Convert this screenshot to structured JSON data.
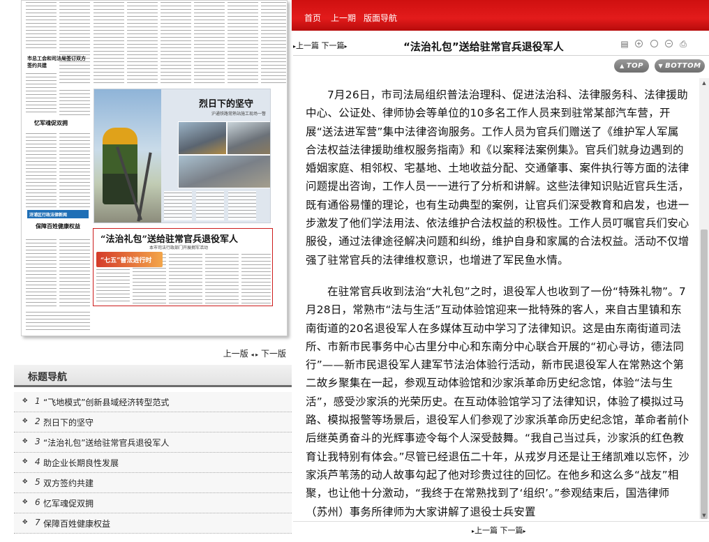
{
  "topbar": {
    "nav_home": "首页",
    "nav_prev_issue": "上一期",
    "nav_layout": "版面导航"
  },
  "article_nav": {
    "prev": "上一篇",
    "next": "下一篇"
  },
  "article": {
    "title": "“法治礼包”送给驻常官兵退役军人",
    "paragraphs": [
      "7月26日，市司法局组织普法治理科、促进法治科、法律服务科、法律援助中心、公证处、律师协会等单位的10多名工作人员来到驻常某部汽车营，开展“送法进军营”集中法律咨询服务。工作人员为官兵们赠送了《维护军人军属合法权益法律援助维权服务指南》和《以案释法案例集》。官兵们就身边遇到的婚姻家庭、相邻权、宅基地、土地收益分配、交通肇事、案件执行等方面的法律问题提出咨询，工作人员一一进行了分析和讲解。这些法律知识贴近官兵生活，既有通俗易懂的理论，也有生动典型的案例，让官兵们深受教育和启发，也进一步激发了他们学法用法、依法维护合法权益的积极性。工作人员叮嘱官兵们安心服役，通过法律途径解决问题和纠纷，维护自身和家属的合法权益。活动不仅增强了驻常官兵的法律维权意识，也增进了军民鱼水情。",
      "在驻常官兵收到法治“大礼包”之时，退役军人也收到了一份“特殊礼物”。7月28日，常熟市“法与生活”互动体验馆迎来一批特殊的客人，来自古里镇和东南街道的20名退役军人在多媒体互动中学习了法律知识。这是由东南街道司法所、市新市民事务中心古里分中心和东南分中心联合开展的“初心寻访，德法同行”——新市民退役军人建军节法治体验行活动，新市民退役军人在常熟这个第二故乡聚集在一起，参观互动体验馆和沙家浜革命历史纪念馆，体验“法与生活”，感受沙家浜的光荣历史。在互动体验馆学习了法律知识，体验了模拟过马路、模拟报警等场景后，退役军人们参观了沙家浜革命历史纪念馆，革命者前仆后继英勇奋斗的光辉事迹令每个人深受鼓舞。“我自己当过兵，沙家浜的红色教育让我特别有体会。”尽管已经退伍二十年，从戎岁月还是让王绪凯难以忘怀，沙家浜芦苇荡的动人故事勾起了他对珍贵过往的回忆。在他乡和这么多“战友”相聚，也让他十分激动，“我终于在常熟找到了‘组织’。”参观结束后，国浩律师（苏州）事务所律师为大家讲解了退役士兵安置"
    ]
  },
  "toolbar": {
    "top_label": "TOP",
    "bottom_label": "BOTTOM"
  },
  "newspaper": {
    "headline_1": "烈日下的坚守",
    "subhead_1": "沪通铁路常熟站施工现场一瞥",
    "headline_2": "“法治礼包”送给驻常官兵退役军人",
    "subhead_2": "本市司法行政部门开展拥军活动",
    "label_red": "“七五”普法进行时",
    "side_head_1": "市总工会和司法局签订双方签约共建",
    "side_head_2": "忆军魂促双拥",
    "side_head_3": "保障百姓健康权益",
    "side_badge": "浒浦区行政法律新闻"
  },
  "version_nav": {
    "prev": "上一版",
    "next": "下一版"
  },
  "toc": {
    "header": "标题导航",
    "items": [
      {
        "num": "1",
        "title": "“飞地模式”创新县域经济转型范式"
      },
      {
        "num": "2",
        "title": "烈日下的坚守"
      },
      {
        "num": "3",
        "title": "“法治礼包”送给驻常官兵退役军人"
      },
      {
        "num": "4",
        "title": "助企业长期良性发展"
      },
      {
        "num": "5",
        "title": "双方签约共建"
      },
      {
        "num": "6",
        "title": "忆军魂促双拥"
      },
      {
        "num": "7",
        "title": "保障百姓健康权益"
      }
    ]
  },
  "colors": {
    "topbar_red": "#e31b1b",
    "highlight_red": "#cc1b1b"
  }
}
